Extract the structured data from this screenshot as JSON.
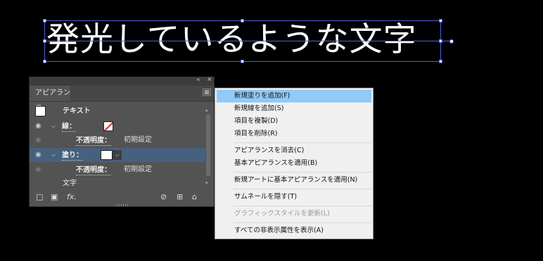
{
  "canvas": {
    "text": "発光しているような文字"
  },
  "panel": {
    "collapse_icon": "double-chevron-left-icon",
    "close_icon": "close-icon",
    "tab_label": "アピアランス",
    "rows": {
      "object_label": "テキスト",
      "stroke_label": "線：",
      "stroke_opacity_label": "不透明度：",
      "stroke_opacity_value": "初期設定",
      "fill_label": "塗り：",
      "fill_opacity_label": "不透明度：",
      "fill_opacity_value": "初期設定",
      "characters_label": "文字"
    },
    "footer_icons": [
      "add-stroke-icon",
      "add-fill-icon",
      "fx-icon",
      "clear-icon",
      "duplicate-icon",
      "trash-icon"
    ]
  },
  "menu": {
    "items": [
      {
        "label": "新規塗りを追加(F)"
      },
      {
        "label": "新規線を追加(S)"
      },
      {
        "label": "項目を複製(D)"
      },
      {
        "label": "項目を削除(R)"
      },
      {
        "label": "アピアランスを消去(C)"
      },
      {
        "label": "基本アピアランスを適用(B)"
      },
      {
        "label": "新規アートに基本アピアランスを適用(N)"
      },
      {
        "label": "サムネールを隠す(T)"
      },
      {
        "label": "グラフィックスタイルを更新(L)"
      },
      {
        "label": "すべての非表示属性を表示(A)"
      }
    ]
  },
  "colors": {
    "selection": "#4a62d8",
    "menu_highlight": "#91c9f7",
    "panel_bg": "#535353",
    "selected_row": "#46617e"
  }
}
